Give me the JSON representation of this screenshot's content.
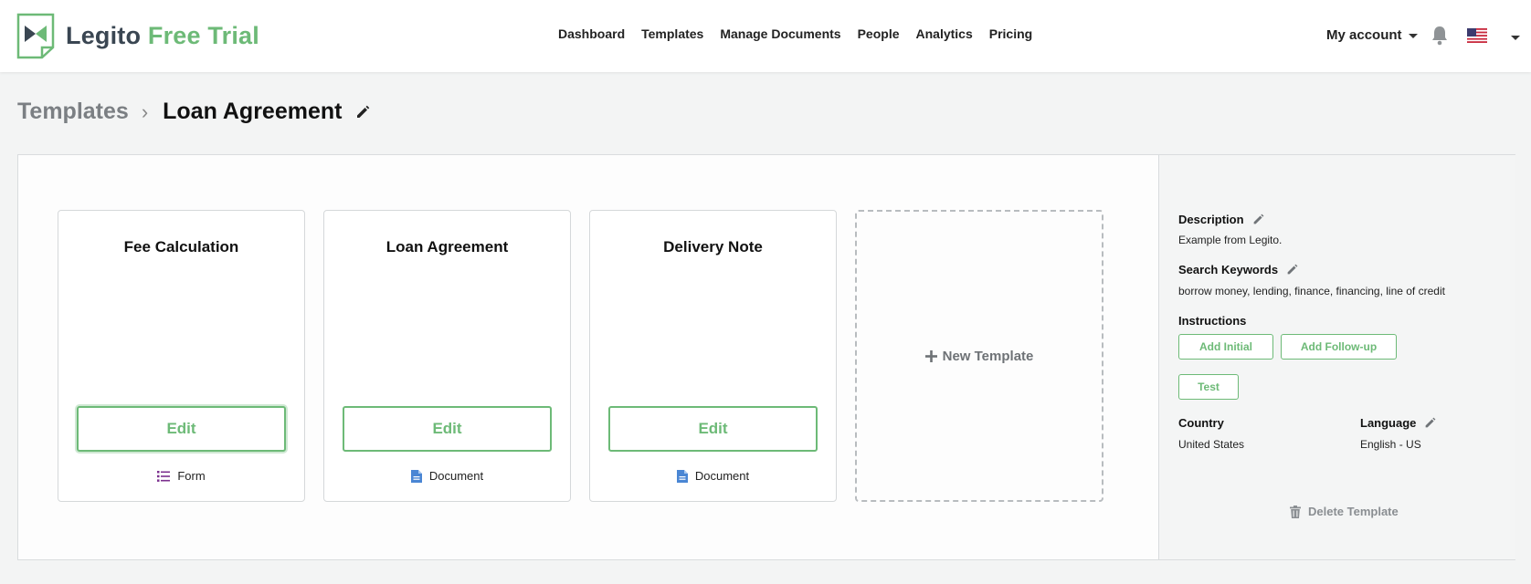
{
  "brand": {
    "name": "Legito",
    "trial": "Free Trial"
  },
  "nav": {
    "items": [
      "Dashboard",
      "Templates",
      "Manage Documents",
      "People",
      "Analytics",
      "Pricing"
    ]
  },
  "account": {
    "label": "My account"
  },
  "breadcrumb": {
    "parent": "Templates",
    "current": "Loan Agreement"
  },
  "cards": [
    {
      "title": "Fee Calculation",
      "edit_label": "Edit",
      "type": "Form",
      "type_icon": "list-icon"
    },
    {
      "title": "Loan Agreement",
      "edit_label": "Edit",
      "type": "Document",
      "type_icon": "document-icon"
    },
    {
      "title": "Delivery Note",
      "edit_label": "Edit",
      "type": "Document",
      "type_icon": "document-icon"
    }
  ],
  "new_template": {
    "label": "New Template"
  },
  "sidebar": {
    "description_label": "Description",
    "description_value": "Example from Legito.",
    "keywords_label": "Search Keywords",
    "keywords_value": "borrow money, lending, finance, financing, line of credit",
    "instructions_label": "Instructions",
    "add_initial": "Add Initial",
    "add_followup": "Add Follow-up",
    "test": "Test",
    "country_label": "Country",
    "country_value": "United States",
    "language_label": "Language",
    "language_value": "English - US",
    "delete_label": "Delete Template"
  },
  "colors": {
    "accent": "#6dba77",
    "form_icon": "#7b2f8e",
    "document_icon": "#4a86d4",
    "muted": "#7b7f83"
  }
}
